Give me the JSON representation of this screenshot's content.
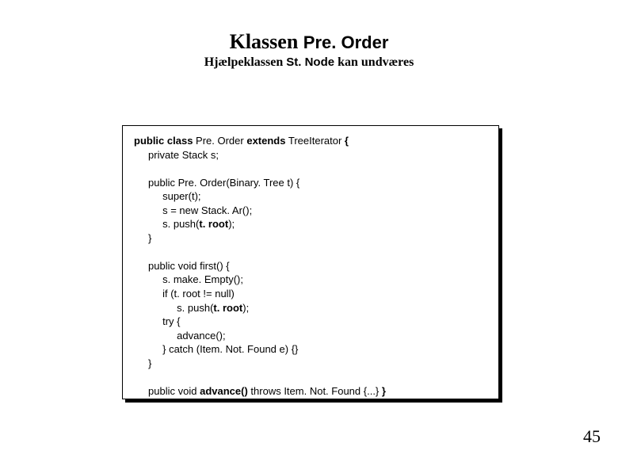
{
  "title": {
    "part1": "Klassen ",
    "part2": "Pre. Order"
  },
  "subtitle": {
    "part1": "Hjælpeklassen ",
    "part2": "St. Node",
    "part3": " kan undværes"
  },
  "code": {
    "blank": " ",
    "l1a": "public class",
    "l1b": " Pre. Order ",
    "l1c": "extends",
    "l1d": " TreeIterator ",
    "l1e": "{",
    "l1f": "",
    "l2": "     private Stack s;",
    "l3": "     public Pre. Order(Binary. Tree t) {",
    "l4": "          super(t);",
    "l5": "          s = new Stack. Ar();",
    "l6a": "          s. push(",
    "l6b": "t. root",
    "l6c": ");",
    "l7": "     }",
    "l8": "     public void first() {",
    "l9": "          s. make. Empty();",
    "l10": "          if (t. root != null)",
    "l11a": "               s. push(",
    "l11b": "t. root",
    "l11c": ");",
    "l12": "          try {",
    "l13": "               advance();",
    "l14": "          } catch (Item. Not. Found e) {}",
    "l15": "     }",
    "l16a": "     public void ",
    "l16b": "advance()",
    "l16c": " throws Item. Not. Found {...} ",
    "l16d": "}"
  },
  "page_number": "45"
}
